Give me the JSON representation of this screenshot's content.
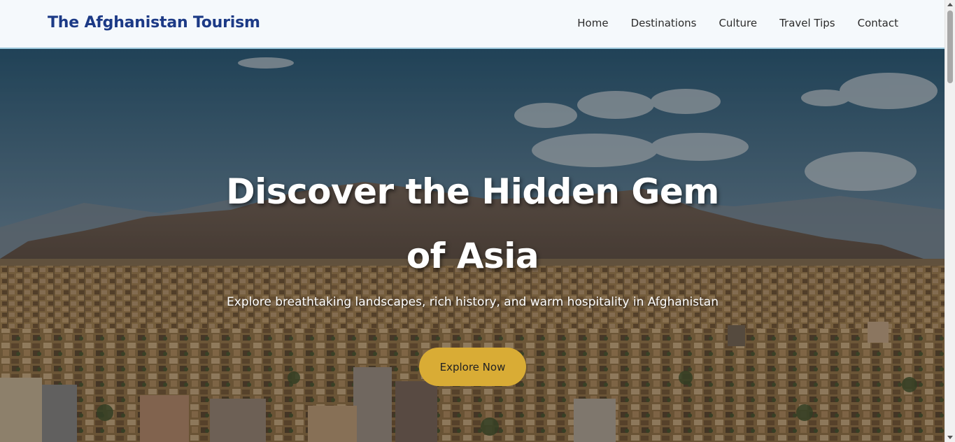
{
  "brand": {
    "title": "The Afghanistan Tourism"
  },
  "nav": {
    "items": [
      {
        "label": "Home"
      },
      {
        "label": "Destinations"
      },
      {
        "label": "Culture"
      },
      {
        "label": "Travel Tips"
      },
      {
        "label": "Contact"
      }
    ]
  },
  "hero": {
    "title": "Discover the Hidden Gem of Asia",
    "subtitle": "Explore breathtaking landscapes, rich history, and warm hospitality in Afghanistan",
    "cta_label": "Explore Now"
  },
  "colors": {
    "brand_text": "#1c3a86",
    "nav_bg": "#f5f9fc",
    "cta_bg": "#d9ac35"
  }
}
